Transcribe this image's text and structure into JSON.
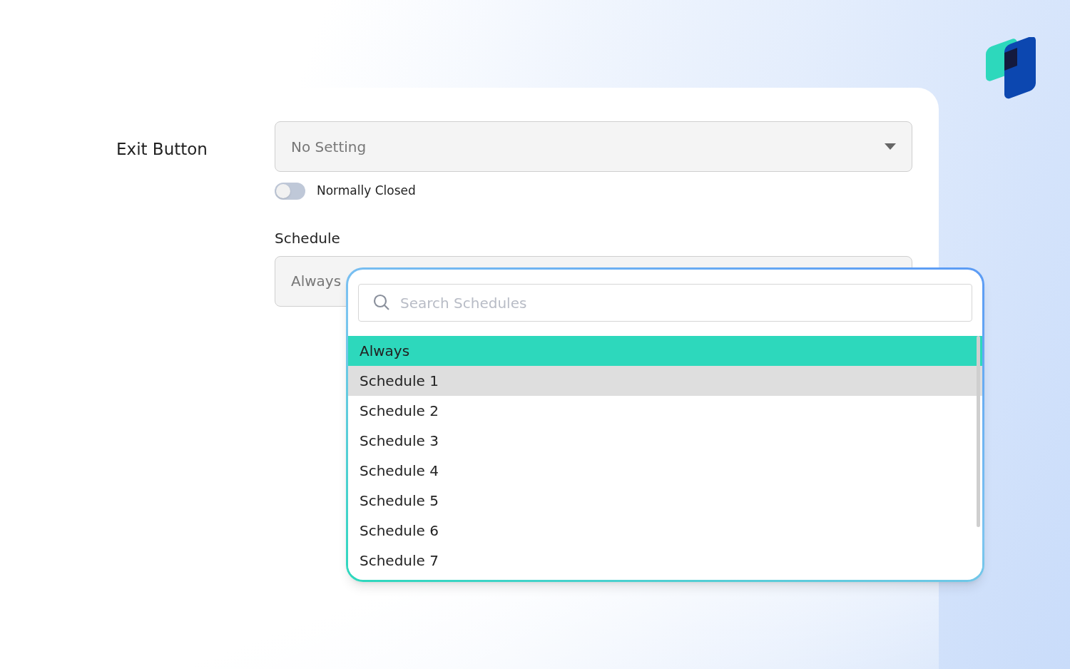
{
  "exit_button": {
    "label": "Exit Button",
    "value": "No Setting",
    "toggle": {
      "label": "Normally Closed",
      "on": false
    }
  },
  "schedule": {
    "label": "Schedule",
    "value": "Always"
  },
  "dropdown": {
    "search": {
      "placeholder": "Search Schedules"
    },
    "options": [
      {
        "label": "Always",
        "selected": true,
        "highlighted": false
      },
      {
        "label": "Schedule 1",
        "selected": false,
        "highlighted": true
      },
      {
        "label": "Schedule 2",
        "selected": false,
        "highlighted": false
      },
      {
        "label": "Schedule 3",
        "selected": false,
        "highlighted": false
      },
      {
        "label": "Schedule 4",
        "selected": false,
        "highlighted": false
      },
      {
        "label": "Schedule 5",
        "selected": false,
        "highlighted": false
      },
      {
        "label": "Schedule 6",
        "selected": false,
        "highlighted": false
      },
      {
        "label": "Schedule 7",
        "selected": false,
        "highlighted": false
      }
    ]
  }
}
